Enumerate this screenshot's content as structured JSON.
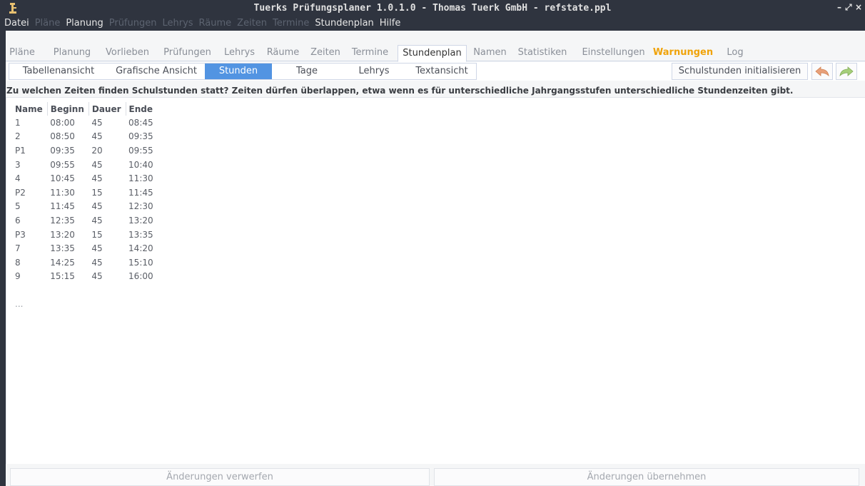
{
  "window": {
    "title": "Tuerks Prüfungsplaner 1.0.1.0 - Thomas Tuerk GmbH - refstate.ppl",
    "minimize": "–",
    "restore": "⤢",
    "close": "×"
  },
  "menubar": {
    "items": [
      {
        "label": "Datei",
        "enabled": true
      },
      {
        "label": "Pläne",
        "enabled": false
      },
      {
        "label": "Planung",
        "enabled": true
      },
      {
        "label": "Prüfungen",
        "enabled": false
      },
      {
        "label": "Lehrys",
        "enabled": false
      },
      {
        "label": "Räume",
        "enabled": false
      },
      {
        "label": "Zeiten",
        "enabled": false
      },
      {
        "label": "Termine",
        "enabled": false
      },
      {
        "label": "Stundenplan",
        "enabled": true
      },
      {
        "label": "Hilfe",
        "enabled": true
      }
    ]
  },
  "main_tabs": [
    {
      "label": "Pläne"
    },
    {
      "label": "Planung"
    },
    {
      "label": "Vorlieben"
    },
    {
      "label": "Prüfungen"
    },
    {
      "label": "Lehrys"
    },
    {
      "label": "Räume"
    },
    {
      "label": "Zeiten"
    },
    {
      "label": "Termine"
    },
    {
      "label": "Stundenplan",
      "active": true
    },
    {
      "label": "Namen"
    },
    {
      "label": "Statistiken"
    },
    {
      "label": "Einstellungen"
    },
    {
      "label": "Warnungen",
      "warning": true
    },
    {
      "label": "Log"
    }
  ],
  "sub_tabs": [
    {
      "label": "Tabellenansicht"
    },
    {
      "label": "Grafische Ansicht"
    },
    {
      "label": "Stunden",
      "active": true
    },
    {
      "label": "Tage"
    },
    {
      "label": "Lehrys"
    },
    {
      "label": "Textansicht"
    }
  ],
  "toolbar": {
    "init_label": "Schulstunden initialisieren",
    "undo_icon": "undo-arrow-icon",
    "redo_icon": "redo-arrow-icon"
  },
  "question": "Zu welchen Zeiten finden Schulstunden statt? Zeiten dürfen überlappen, etwa wenn es für unterschiedliche Jahrgangsstufen unterschiedliche Stundenzeiten gibt.",
  "table": {
    "headers": [
      "Name",
      "Beginn",
      "Dauer",
      "Ende"
    ],
    "rows": [
      [
        "1",
        "08:00",
        "45",
        "08:45"
      ],
      [
        "2",
        "08:50",
        "45",
        "09:35"
      ],
      [
        "P1",
        "09:35",
        "20",
        "09:55"
      ],
      [
        "3",
        "09:55",
        "45",
        "10:40"
      ],
      [
        "4",
        "10:45",
        "45",
        "11:30"
      ],
      [
        "P2",
        "11:30",
        "15",
        "11:45"
      ],
      [
        "5",
        "11:45",
        "45",
        "12:30"
      ],
      [
        "6",
        "12:35",
        "45",
        "13:20"
      ],
      [
        "P3",
        "13:20",
        "15",
        "13:35"
      ],
      [
        "7",
        "13:35",
        "45",
        "14:20"
      ],
      [
        "8",
        "14:25",
        "45",
        "15:10"
      ],
      [
        "9",
        "15:15",
        "45",
        "16:00"
      ]
    ],
    "more": "..."
  },
  "bottom": {
    "discard_label": "Änderungen verwerfen",
    "apply_label": "Änderungen übernehmen"
  },
  "colors": {
    "titlebar_bg": "#2f343f",
    "accent": "#5294e2",
    "warning": "#f0a30a",
    "undo_icon": "#e8a07a",
    "redo_icon": "#a6cf7a"
  }
}
